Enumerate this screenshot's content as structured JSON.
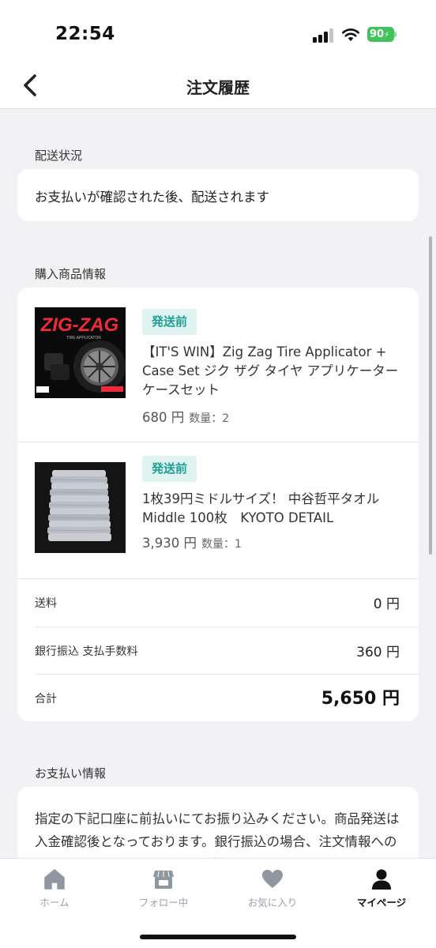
{
  "status_bar": {
    "time": "22:54",
    "battery": "90"
  },
  "nav": {
    "title": "注文履歴",
    "back_icon": "chevron-left-icon"
  },
  "shipping": {
    "section_label": "配送状況",
    "message": "お支払いが確認された後、配送されます"
  },
  "products": {
    "section_label": "購入商品情報",
    "items": [
      {
        "status": "発送前",
        "name": "【IT'S WIN】Zig Zag Tire Applicator + Case Set ジク ザグ タイヤ アプリケーター ケースセット",
        "price": "680 円",
        "quantity": "数量：2",
        "image_text": "ZIG-ZAG",
        "image_subtext": "TIRE APPLICATOR"
      },
      {
        "status": "発送前",
        "name": "1枚39円ミドルサイズ！ 中谷哲平タオル Middle 100枚　KYOTO DETAIL",
        "price": "3,930 円",
        "quantity": "数量：1"
      }
    ]
  },
  "summary": {
    "shipping_label": "送料",
    "shipping_value": "0 円",
    "fee_label": "銀行振込 支払手数料",
    "fee_value": "360 円",
    "total_label": "合計",
    "total_value": "5,650 円"
  },
  "payment": {
    "section_label": "お支払い情報",
    "text": "指定の下記口座に前払いにてお振り込みください。商品発送は入金確認後となっております。銀行振込の場合、注文情報への反映に時間がかかる場合がございます。あ"
  },
  "tabs": [
    {
      "label": "ホーム",
      "icon": "home-icon",
      "active": false
    },
    {
      "label": "フォロー中",
      "icon": "store-icon",
      "active": false
    },
    {
      "label": "お気に入り",
      "icon": "heart-icon",
      "active": false
    },
    {
      "label": "マイページ",
      "icon": "person-icon",
      "active": true
    }
  ],
  "colors": {
    "badge_bg": "#dff4f1",
    "badge_text": "#1f9f93",
    "tab_inactive": "#9aa2aa",
    "tab_active": "#111111",
    "battery": "#3fc35a"
  }
}
